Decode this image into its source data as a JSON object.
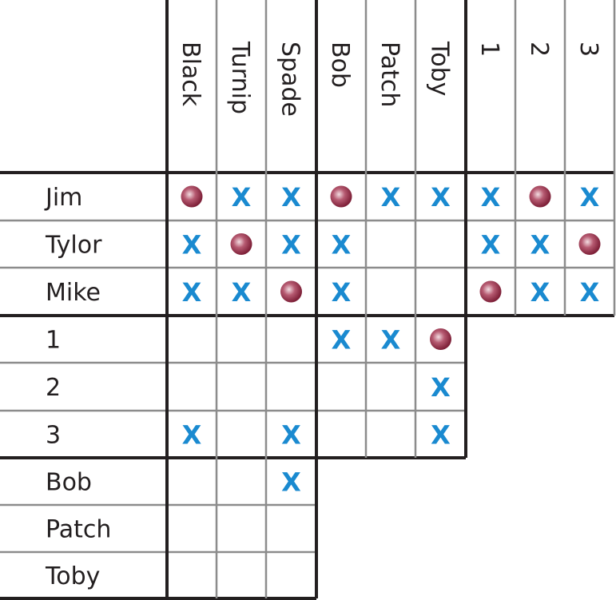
{
  "column_headers": [
    "Black",
    "Turnip",
    "Spade",
    "Bob",
    "Patch",
    "Toby",
    "1",
    "2",
    "3"
  ],
  "row_labels": [
    "Jim",
    "Tylor",
    "Mike",
    "1",
    "2",
    "3",
    "Bob",
    "Patch",
    "Toby"
  ],
  "marks": {
    "x_symbol": "X",
    "x_color": "#1a8ad0",
    "circle_color": "#9e2f4a"
  },
  "cells": [
    [
      "O",
      "X",
      "X",
      "O",
      "X",
      "X",
      "X",
      "O",
      "X"
    ],
    [
      "X",
      "O",
      "X",
      "X",
      "",
      "",
      "X",
      "X",
      "O"
    ],
    [
      "X",
      "X",
      "O",
      "X",
      "",
      "",
      "O",
      "X",
      "X"
    ],
    [
      "",
      "",
      "",
      "X",
      "X",
      "O"
    ],
    [
      "",
      "",
      "",
      "",
      "",
      "X"
    ],
    [
      "X",
      "",
      "X",
      "",
      "",
      "X"
    ],
    [
      "",
      "",
      "X"
    ],
    [
      "",
      "",
      ""
    ],
    [
      "",
      "",
      ""
    ]
  ]
}
